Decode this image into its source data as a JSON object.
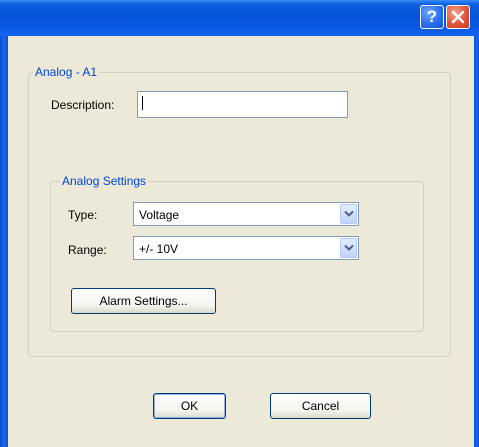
{
  "window": {
    "title": "",
    "help_glyph": "?",
    "help_icon": "help-icon",
    "close_icon": "close-icon"
  },
  "analog_group": {
    "label": "Analog - A1",
    "description_label": "Description:",
    "description_value": ""
  },
  "settings_group": {
    "label": "Analog Settings",
    "type_label": "Type:",
    "type_value": "Voltage",
    "range_label": "Range:",
    "range_value": "+/- 10V",
    "alarm_button": "Alarm Settings..."
  },
  "footer": {
    "ok_label": "OK",
    "cancel_label": "Cancel"
  },
  "colors": {
    "titlebar": "#0653d8",
    "group_label": "#0046d5",
    "dialog_bg": "#ece9d8",
    "close_red": "#e0543a"
  }
}
